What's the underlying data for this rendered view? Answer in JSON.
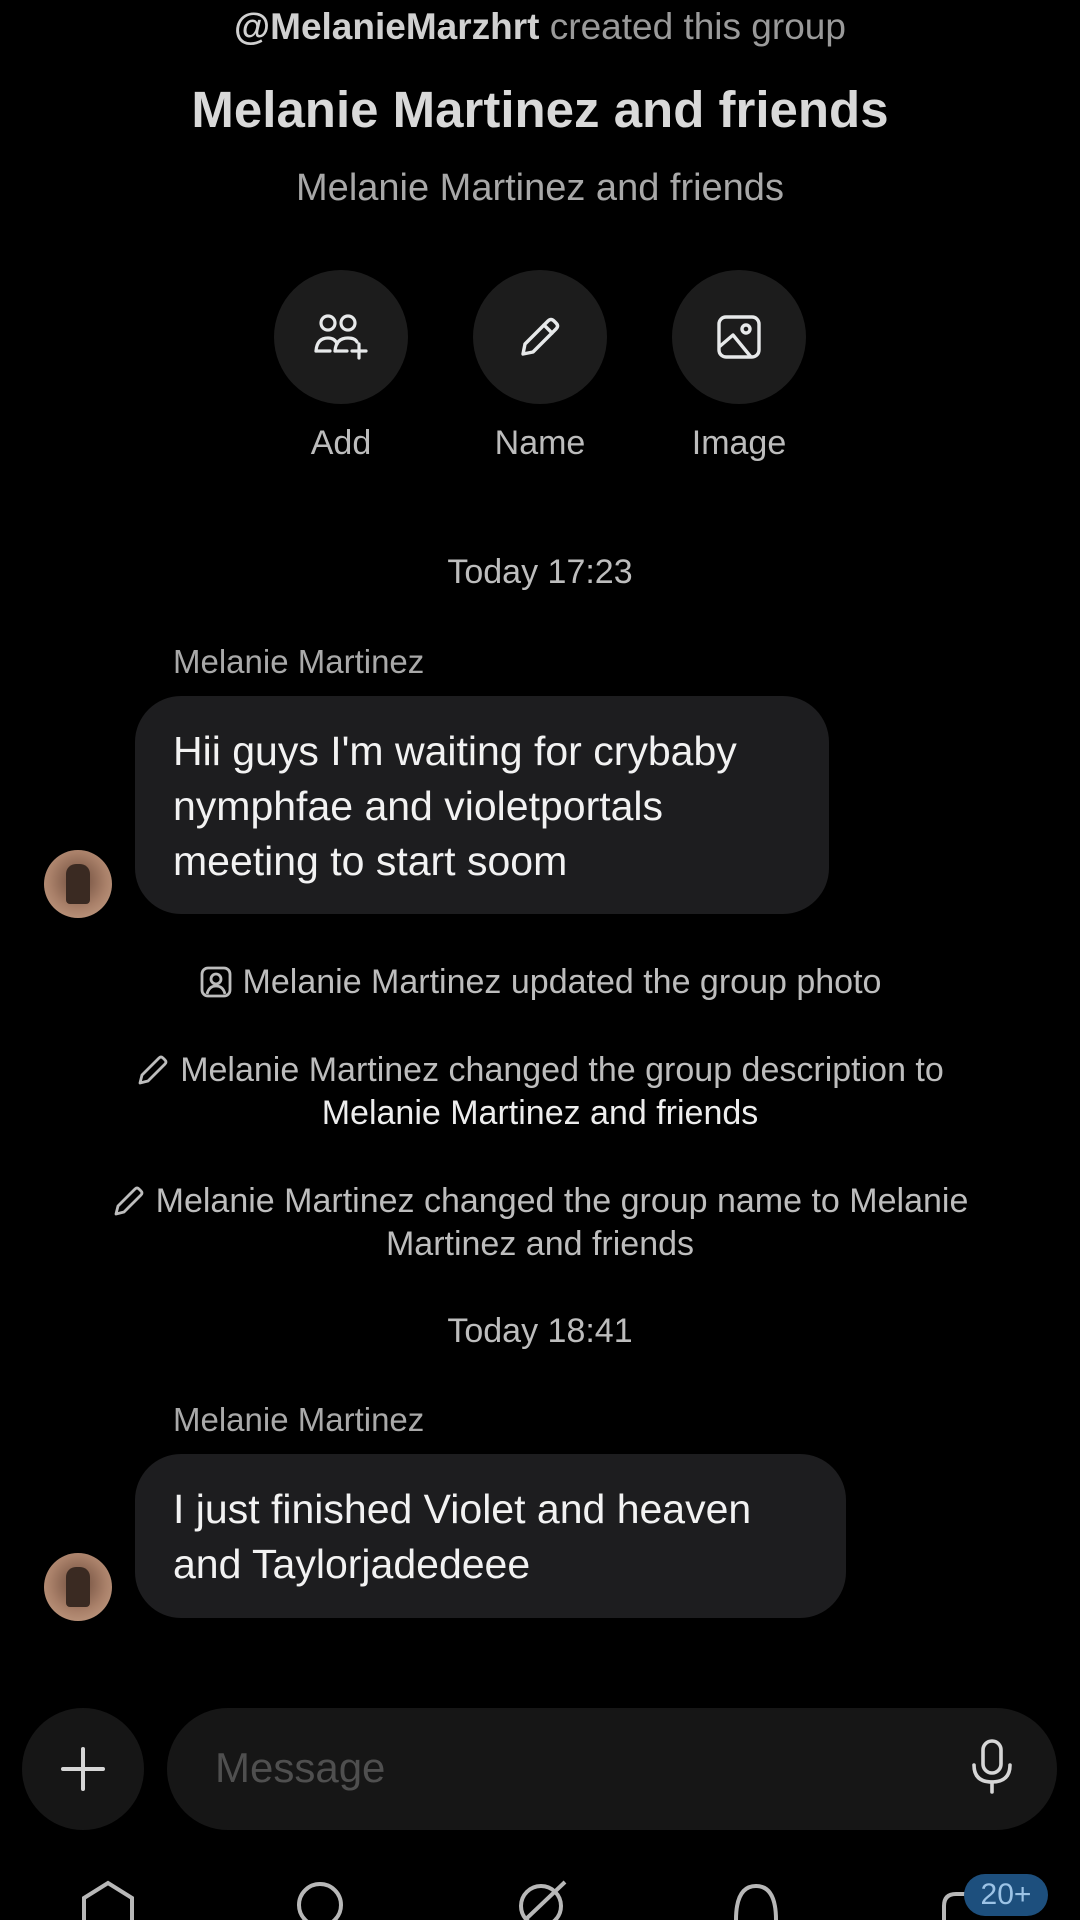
{
  "header": {
    "creator_handle": "@MelanieMarzhrt",
    "creator_suffix": " created this group",
    "group_name": "Melanie Martinez and friends",
    "group_description": "Melanie Martinez and friends"
  },
  "actions": [
    {
      "label": "Add",
      "icon": "add-people-icon"
    },
    {
      "label": "Name",
      "icon": "pencil-icon"
    },
    {
      "label": "Image",
      "icon": "image-icon"
    }
  ],
  "messages": [
    {
      "timestamp": "Today 17:23",
      "sender": "Melanie Martinez",
      "lines": [
        "Hii guys I'm waiting for crybaby",
        "nymphfae and violetportals",
        "meeting to start soom"
      ]
    },
    {
      "timestamp": "Today 18:41",
      "sender": "Melanie Martinez",
      "lines": [
        "I just finished Violet and heaven",
        "and Taylorjadedeee"
      ]
    }
  ],
  "system_events": [
    {
      "icon": "portrait-icon",
      "text": "Melanie Martinez updated the group photo"
    },
    {
      "icon": "pencil-icon",
      "line1": "Melanie Martinez changed the group description to",
      "line2": "Melanie Martinez and friends"
    },
    {
      "icon": "pencil-icon",
      "line1": "Melanie Martinez changed the group name to Melanie",
      "line2": "Martinez and friends"
    }
  ],
  "composer": {
    "placeholder": "Message",
    "plus_icon": "plus-icon",
    "mic_icon": "microphone-icon"
  },
  "tabbar": {
    "icons": [
      "home-icon",
      "search-icon",
      "grok-icon",
      "notifications-icon",
      "messages-icon"
    ],
    "badge": "20+"
  },
  "colors": {
    "background": "#000000",
    "bubble": "#1d1d1f",
    "badge": "#1d4f7d"
  }
}
